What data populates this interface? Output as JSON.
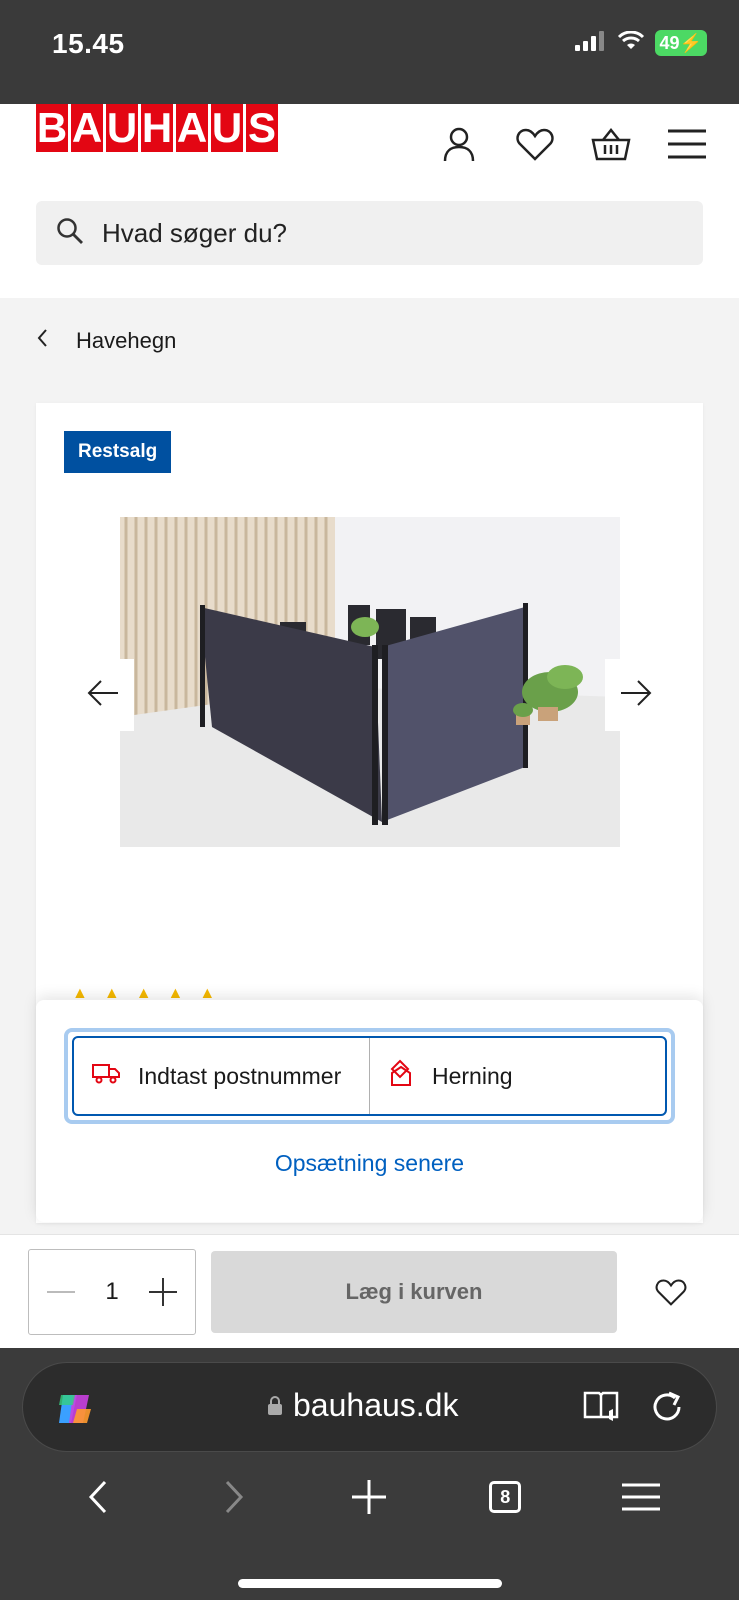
{
  "status_bar": {
    "time": "15.45",
    "battery": "49"
  },
  "header": {
    "logo_text": "BAUHAUS",
    "search_placeholder": "Hvad søger du?",
    "icons": [
      "account-icon",
      "heart-icon",
      "basket-icon",
      "menu-icon"
    ]
  },
  "breadcrumb": {
    "label": "Havehegn"
  },
  "product": {
    "badge": "Restsalg",
    "rating_stars": 5
  },
  "delivery": {
    "postcode_label": "Indtast postnummer",
    "store_label": "Herning",
    "setup_later": "Opsætning senere"
  },
  "actions": {
    "quantity": "1",
    "add_to_cart": "Læg i kurven"
  },
  "browser": {
    "url": "bauhaus.dk",
    "tabs_count": "8"
  },
  "colors": {
    "brand_red": "#e30613",
    "badge_blue": "#0050a0",
    "link_blue": "#0060c0"
  }
}
